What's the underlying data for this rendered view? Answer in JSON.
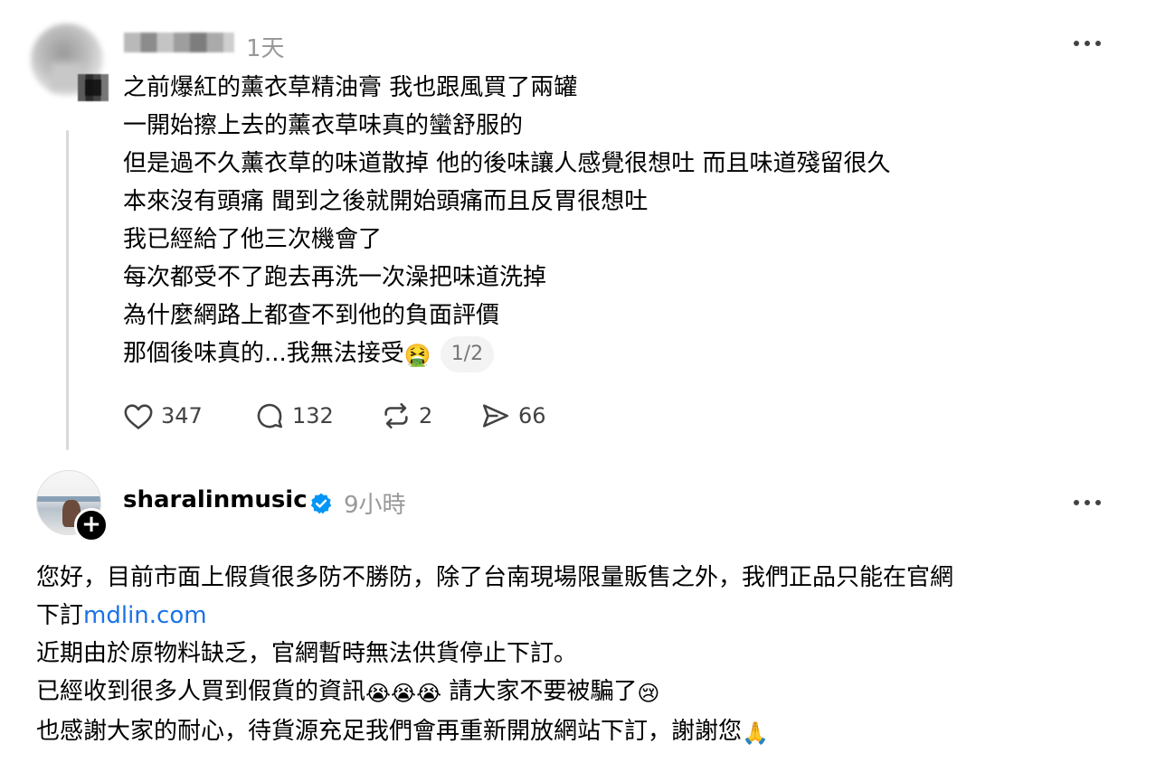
{
  "post1": {
    "time": "1天",
    "lines": [
      "之前爆紅的薰衣草精油膏 我也跟風買了兩罐",
      "一開始擦上去的薰衣草味真的蠻舒服的",
      "但是過不久薰衣草的味道散掉 他的後味讓人感覺很想吐 而且味道殘留很久",
      "本來沒有頭痛 聞到之後就開始頭痛而且反胃很想吐",
      "我已經給了他三次機會了",
      "每次都受不了跑去再洗一次澡把味道洗掉",
      "為什麼網路上都查不到他的負面評價"
    ],
    "last_line": "那個後味真的...我無法接受",
    "last_emoji": "🤮",
    "page_indicator": "1/2",
    "likes": "347",
    "replies": "132",
    "reposts": "2",
    "shares": "66"
  },
  "post2": {
    "username": "sharalinmusic",
    "time": "9小時",
    "line1": "您好，目前市面上假貨很多防不勝防，除了台南現場限量販售之外，我們正品只能在官網",
    "line2_prefix": "下訂",
    "link": "mdlin.com",
    "line3": "近期由於原物料缺乏，官網暫時無法供貨停止下訂。",
    "line4_prefix": "已經收到很多人買到假貨的資訊",
    "line4_emojis": "😭😭😭",
    "line4_suffix": " 請大家不要被騙了",
    "line4_emoji_end": "😢",
    "line5": "也感謝大家的耐心，待貨源充足我們會再重新開放網站下訂，謝謝您",
    "line5_emoji": "🙏"
  },
  "colors": {
    "link": "#1a73e8",
    "verified": "#0095f6",
    "muted": "#999999"
  }
}
